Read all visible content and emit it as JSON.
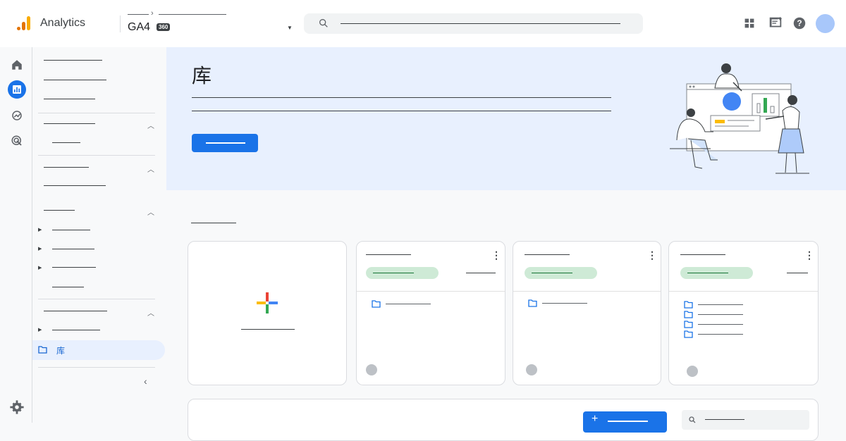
{
  "app": {
    "name": "Analytics"
  },
  "breadcrumb": {
    "property": "GA4",
    "badge": "360"
  },
  "hero": {
    "title": "库"
  },
  "nav": {
    "selected_label": "库"
  },
  "icons": {
    "rail": [
      "home-icon",
      "reports-icon",
      "explore-icon",
      "advertising-icon",
      "settings-icon"
    ],
    "topbar": [
      "search-icon",
      "apps-icon",
      "feedback-icon",
      "help-icon"
    ]
  },
  "colors": {
    "accent": "#1a73e8",
    "hero_bg": "#e8f0fe",
    "chip": "#ceead6",
    "logo_orange": "#e37400",
    "logo_yellow": "#f9ab00"
  }
}
